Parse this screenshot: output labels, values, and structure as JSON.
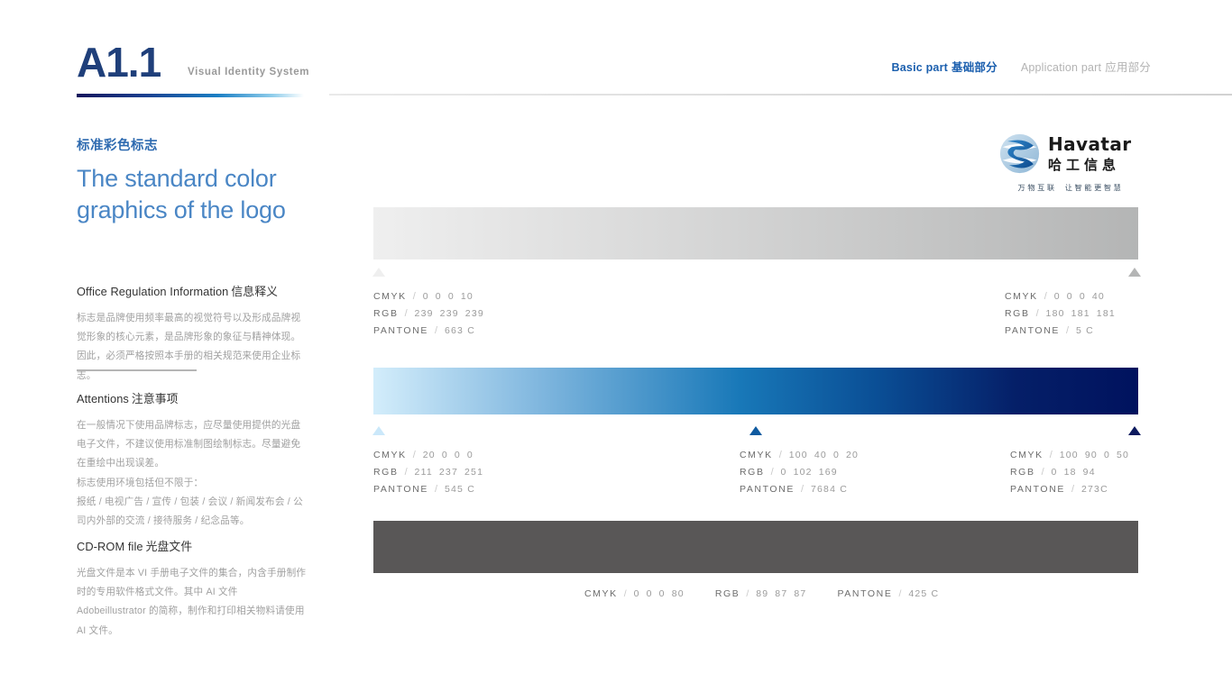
{
  "header": {
    "code": "A1.1",
    "subtitle": "Visual Identity System",
    "nav": [
      {
        "en": "Basic part",
        "cn": "基础部分",
        "state": "active"
      },
      {
        "en": "Application part",
        "cn": "应用部分",
        "state": "inactive"
      }
    ]
  },
  "left": {
    "cn_title": "标准彩色标志",
    "en_title_line1": "The standard color",
    "en_title_line2": "graphics of the logo",
    "sections": [
      {
        "heading_en": "Office Regulation Information",
        "heading_cn": "信息释义",
        "body": "标志是品牌使用频率最高的视觉符号以及形成品牌视觉形象的核心元素，是品牌形象的象征与精神体现。因此，必须严格按照本手册的相关规范来使用企业标志。"
      },
      {
        "heading_en": "Attentions",
        "heading_cn": "注意事项",
        "body": "在一般情况下使用品牌标志，应尽量使用提供的光盘电子文件，不建议使用标准制图绘制标志。尽量避免在重绘中出现误差。\n标志使用环境包括但不限于：\n报纸 / 电视广告 / 宣传 / 包装 / 会议 / 新闻发布会 / 公司内外部的交流 / 接待服务 / 纪念品等。"
      },
      {
        "heading_en": "CD-ROM file",
        "heading_cn": "光盘文件",
        "body": "光盘文件是本 VI 手册电子文件的集合，内含手册制作时的专用软件格式文件。其中 AI 文件 Adobeillustrator 的简称，制作和打印相关物料请使用 AI 文件。"
      }
    ]
  },
  "logo": {
    "wordmark": "Havatar",
    "cn_name": "哈工信息",
    "slogan_left": "万物互联",
    "slogan_right": "让智能更智慧",
    "mark_color_light": "#7fb2d8",
    "mark_color_dark": "#1b5fa8"
  },
  "swatches": {
    "gray_bar": {
      "gradient_from": "#efefef",
      "gradient_to": "#b4b5b5",
      "specs": [
        {
          "marker_color": "#efefef",
          "cmyk_label": "CMYK",
          "cmyk": [
            "0",
            "0",
            "0",
            "10"
          ],
          "rgb_label": "RGB",
          "rgb": [
            "239",
            "239",
            "239"
          ],
          "pantone_label": "PANTONE",
          "pantone": "663 C"
        },
        {
          "marker_color": "#b4b5b5",
          "cmyk_label": "CMYK",
          "cmyk": [
            "0",
            "0",
            "0",
            "40"
          ],
          "rgb_label": "RGB",
          "rgb": [
            "180",
            "181",
            "181"
          ],
          "pantone_label": "PANTONE",
          "pantone": "5 C"
        }
      ]
    },
    "blue_bar": {
      "gradient_from": "#d3edfb",
      "gradient_mid": "#0066a9",
      "gradient_to": "#00125e",
      "specs": [
        {
          "marker_color": "#d3edfb",
          "cmyk_label": "CMYK",
          "cmyk": [
            "20",
            "0",
            "0",
            "0"
          ],
          "rgb_label": "RGB",
          "rgb": [
            "211",
            "237",
            "251"
          ],
          "pantone_label": "PANTONE",
          "pantone": "545 C"
        },
        {
          "marker_color": "#0066a9",
          "cmyk_label": "CMYK",
          "cmyk": [
            "100",
            "40",
            "0",
            "20"
          ],
          "rgb_label": "RGB",
          "rgb": [
            "0",
            "102",
            "169"
          ],
          "pantone_label": "PANTONE",
          "pantone": "7684 C"
        },
        {
          "marker_color": "#00125e",
          "cmyk_label": "CMYK",
          "cmyk": [
            "100",
            "90",
            "0",
            "50"
          ],
          "rgb_label": "RGB",
          "rgb": [
            "0",
            "18",
            "94"
          ],
          "pantone_label": "PANTONE",
          "pantone": "273C"
        }
      ]
    },
    "dark_bar": {
      "fill": "#595757",
      "spec": {
        "cmyk_label": "CMYK",
        "cmyk": [
          "0",
          "0",
          "0",
          "80"
        ],
        "rgb_label": "RGB",
        "rgb": [
          "89",
          "87",
          "87"
        ],
        "pantone_label": "PANTONE",
        "pantone": "425 C"
      }
    }
  }
}
